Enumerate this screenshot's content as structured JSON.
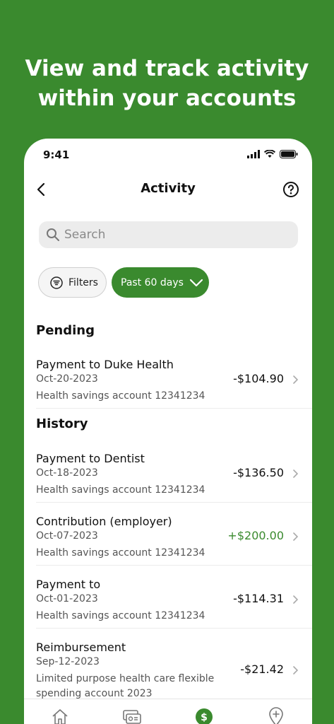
{
  "headline": {
    "line1": "View and track activity",
    "line2": "within your accounts"
  },
  "status_bar": {
    "time": "9:41"
  },
  "nav": {
    "title": "Activity"
  },
  "search": {
    "placeholder": "Search"
  },
  "filters": {
    "filters_label": "Filters",
    "period_label": "Past 60 days"
  },
  "sections": {
    "pending": "Pending",
    "history": "History"
  },
  "pending": [
    {
      "title": "Payment to Duke Health",
      "date": "Oct-20-2023",
      "account": "Health savings account 12341234",
      "amount": "-$104.90"
    }
  ],
  "history": [
    {
      "title": "Payment to Dentist",
      "date": "Oct-18-2023",
      "account": "Health savings account 12341234",
      "amount": "-$136.50"
    },
    {
      "title": "Contribution (employer)",
      "date": "Oct-07-2023",
      "account": "Health savings account 12341234",
      "amount": "+$200.00"
    },
    {
      "title": "Payment to",
      "date": "Oct-01-2023",
      "account": "Health savings account 12341234",
      "amount": "-$114.31"
    },
    {
      "title": "Reimbursement",
      "date": "Sep-12-2023",
      "account": "Limited purpose health care flexible spending account 2023",
      "amount": "-$21.42"
    }
  ],
  "tabs": {
    "wallet_symbol": "$"
  },
  "colors": {
    "brand_green": "#3a8a2e",
    "positive_amount": "#3a8a2e",
    "background": "#ffffff"
  },
  "icons": [
    "back-chevron-icon",
    "help-icon",
    "search-icon",
    "filter-icon",
    "chevron-down-icon",
    "chevron-right-icon",
    "home-icon",
    "cards-icon",
    "dollar-icon",
    "location-icon"
  ]
}
